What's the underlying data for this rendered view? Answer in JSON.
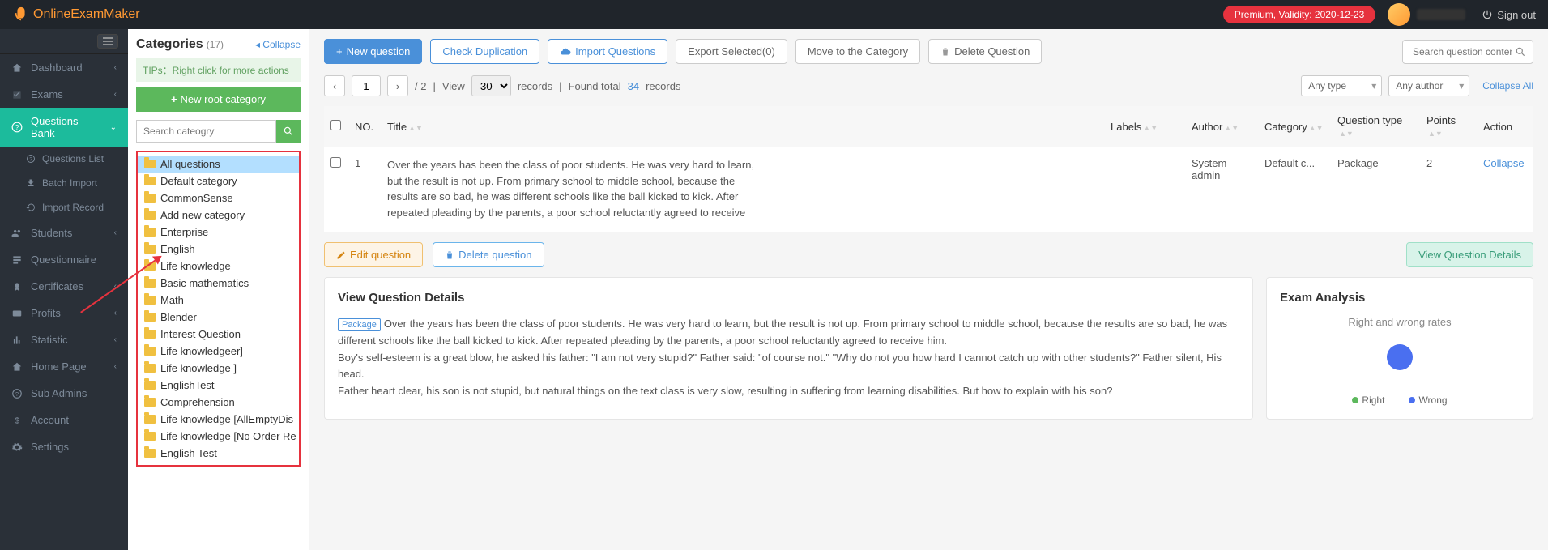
{
  "brand": "OnlineExamMaker",
  "premium": "Premium, Validity: 2020-12-23",
  "signout": "Sign out",
  "nav": {
    "dashboard": "Dashboard",
    "exams": "Exams",
    "questions_bank": "Questions Bank",
    "questions_list": "Questions List",
    "batch_import": "Batch Import",
    "import_record": "Import Record",
    "students": "Students",
    "questionnaire": "Questionnaire",
    "certificates": "Certificates",
    "profits": "Profits",
    "statistic": "Statistic",
    "home_page": "Home Page",
    "sub_admins": "Sub Admins",
    "account": "Account",
    "settings": "Settings"
  },
  "categories": {
    "title": "Categories",
    "count": "(17)",
    "collapse": "Collapse",
    "tips": "TIPs：Right click for more actions",
    "new_root": "New root category",
    "search_ph": "Search cateogry",
    "items": [
      "All questions",
      "Default category",
      "CommonSense",
      "Add new category",
      "Enterprise",
      "English",
      "Life knowledge",
      "Basic mathematics",
      "Math",
      "Blender",
      "Interest Question",
      "Life knowledgeer]",
      "Life knowledge ]",
      "EnglishTest",
      "Comprehension",
      "Life knowledge [AllEmptyDis",
      "Life knowledge [No Order Re",
      "English Test"
    ]
  },
  "toolbar": {
    "new_q": "New question",
    "check_dup": "Check Duplication",
    "import_q": "Import Questions",
    "export": "Export Selected(0)",
    "move": "Move to the Category",
    "delete_q": "Delete Question",
    "search_ph": "Search question content"
  },
  "pager": {
    "page": "1",
    "total_pages": "/ 2",
    "view": "View",
    "per": "30",
    "records": "records",
    "found_prefix": "Found total",
    "found_count": "34",
    "found_suffix": "records",
    "any_type": "Any type",
    "any_author": "Any author",
    "collapse_all": "Collapse All"
  },
  "table": {
    "h_no": "NO.",
    "h_title": "Title",
    "h_labels": "Labels",
    "h_author": "Author",
    "h_category": "Category",
    "h_qtype": "Question type",
    "h_points": "Points",
    "h_action": "Action",
    "row": {
      "no": "1",
      "title": "Over the years has been the class of poor students. He was very hard to learn, but the result is not up. From primary school to middle school, because the results are so bad, he was different schools like the ball kicked to kick. After repeated pleading by the parents, a poor school reluctantly agreed to receive him.\nBoy's self esteem is a great blow, he asked his father: \"I am not very stupid?\" Father said: \"of",
      "author": "System admin",
      "category": "Default c...",
      "qtype": "Package",
      "points": "2",
      "collapse": "Collapse"
    }
  },
  "actions": {
    "edit": "Edit question",
    "delete": "Delete question",
    "view": "View Question Details"
  },
  "details": {
    "title": "View Question Details",
    "tag": "Package",
    "text1": "Over the years has been the class of poor students. He was very hard to learn, but the result is not up. From primary school to middle school, because the results are so bad, he was different schools like the ball kicked to kick. After repeated pleading by the parents, a poor school reluctantly agreed to receive him.",
    "text2": "Boy's self-esteem is a great blow, he asked his father: \"I am not very stupid?\" Father said: \"of course not.\" \"Why do not you how hard I cannot catch up with other students?\" Father silent, His head.",
    "text3": "Father heart clear, his son is not stupid, but natural things on the text class is very slow, resulting in suffering from learning disabilities. But how to explain with his son?"
  },
  "analysis": {
    "title": "Exam Analysis",
    "chart_title": "Right and wrong rates",
    "right": "Right",
    "wrong": "Wrong"
  },
  "chart_data": {
    "type": "pie",
    "title": "Right and wrong rates",
    "series": [
      {
        "name": "Right",
        "value": 0,
        "color": "#5cb85c"
      },
      {
        "name": "Wrong",
        "value": 100,
        "color": "#4a6ff0"
      }
    ]
  }
}
